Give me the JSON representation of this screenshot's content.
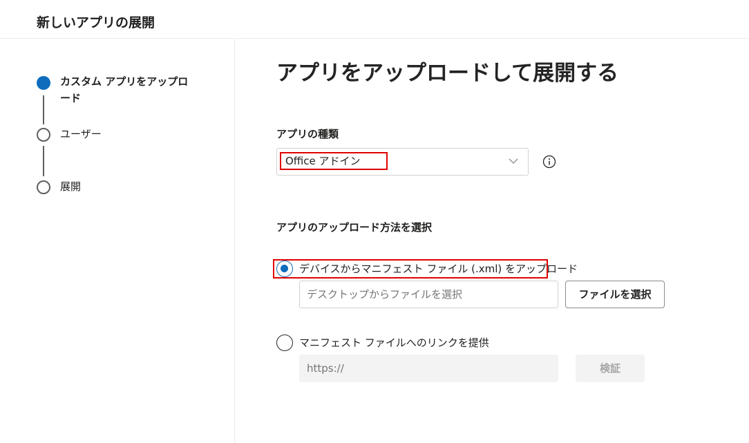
{
  "header": {
    "title": "新しいアプリの展開"
  },
  "steps": [
    {
      "label": "カスタム アプリをアップロード",
      "state": "active"
    },
    {
      "label": "ユーザー",
      "state": "inactive"
    },
    {
      "label": "展開",
      "state": "inactive"
    }
  ],
  "main": {
    "title": "アプリをアップロードして展開する",
    "app_type": {
      "label": "アプリの種類",
      "selected": "Office アドイン",
      "info_icon": "info-icon"
    },
    "upload_method": {
      "label": "アプリのアップロード方法を選択",
      "options": [
        {
          "label": "デバイスからマニフェスト ファイル (.xml) をアップロード",
          "checked": true,
          "input_placeholder": "デスクトップからファイルを選択",
          "button_label": "ファイルを選択"
        },
        {
          "label": "マニフェスト ファイルへのリンクを提供",
          "checked": false,
          "input_placeholder": "https://",
          "button_label": "検証"
        }
      ]
    }
  },
  "colors": {
    "accent": "#0f6cbd",
    "highlight": "#e00000"
  }
}
